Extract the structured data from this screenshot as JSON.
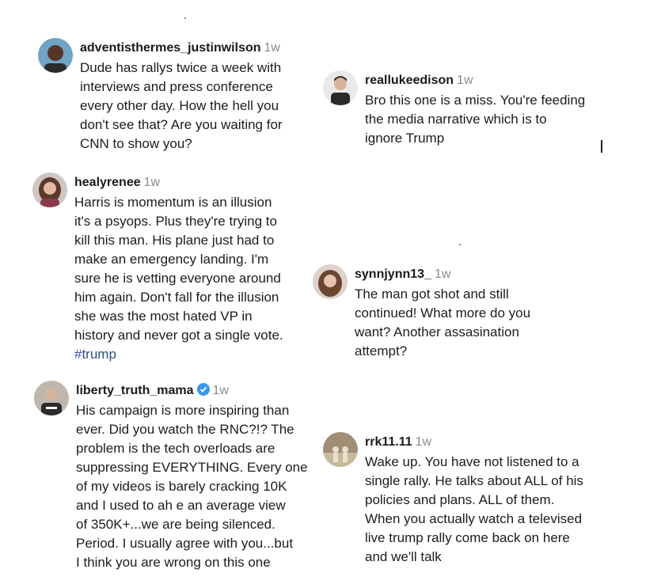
{
  "comments": [
    {
      "username": "adventisthermes_justinwilson",
      "time": "1w",
      "lines": [
        "Dude has rallys twice a week with",
        "interviews and press conference",
        "every other day. How the hell you",
        "don't see that? Are you waiting for",
        "CNN to show you?"
      ]
    },
    {
      "username": "reallukeedison",
      "time": "1w",
      "lines": [
        "Bro this one is a miss. You're feeding",
        "the media narrative which is to",
        "ignore Trump"
      ]
    },
    {
      "username": "healyrenee",
      "time": "1w",
      "lines": [
        "Harris is momentum is an illusion",
        "it's a psyops. Plus they're trying to",
        "kill this man. His plane just had to",
        "make an emergency landing. I'm",
        "sure he is vetting everyone around",
        "him again. Don't fall for the illusion",
        "she was the most hated VP in",
        "history and never got a single vote."
      ],
      "hashtag": "#trump"
    },
    {
      "username": "synnjynn13_",
      "time": "1w",
      "lines": [
        "The man got shot and still",
        "continued! What more do you",
        "want? Another assasination",
        "attempt?"
      ]
    },
    {
      "username": "liberty_truth_mama",
      "time": "1w",
      "verified": true,
      "lines": [
        "His campaign is more inspiring than",
        "ever. Did you watch the RNC?!? The",
        "problem is the tech overloads are",
        "suppressing EVERYTHING. Every one",
        "of my videos is barely cracking 10K",
        "and I used to ah e an average view",
        "of 350K+...we are being silenced.",
        "Period. I usually agree with you...but",
        "I think you are wrong on this one"
      ]
    },
    {
      "username": "rrk11.11",
      "time": "1w",
      "lines": [
        "Wake up. You have not listened to a",
        "single rally. He talks about ALL of his",
        "policies and plans. ALL of them.",
        "When you actually watch a televised",
        "live trump rally come back on here",
        "and we'll talk"
      ]
    }
  ],
  "colors": {
    "verified": "#3897f0",
    "hashtag": "#2f4f8a",
    "time": "#8a8a8a"
  }
}
